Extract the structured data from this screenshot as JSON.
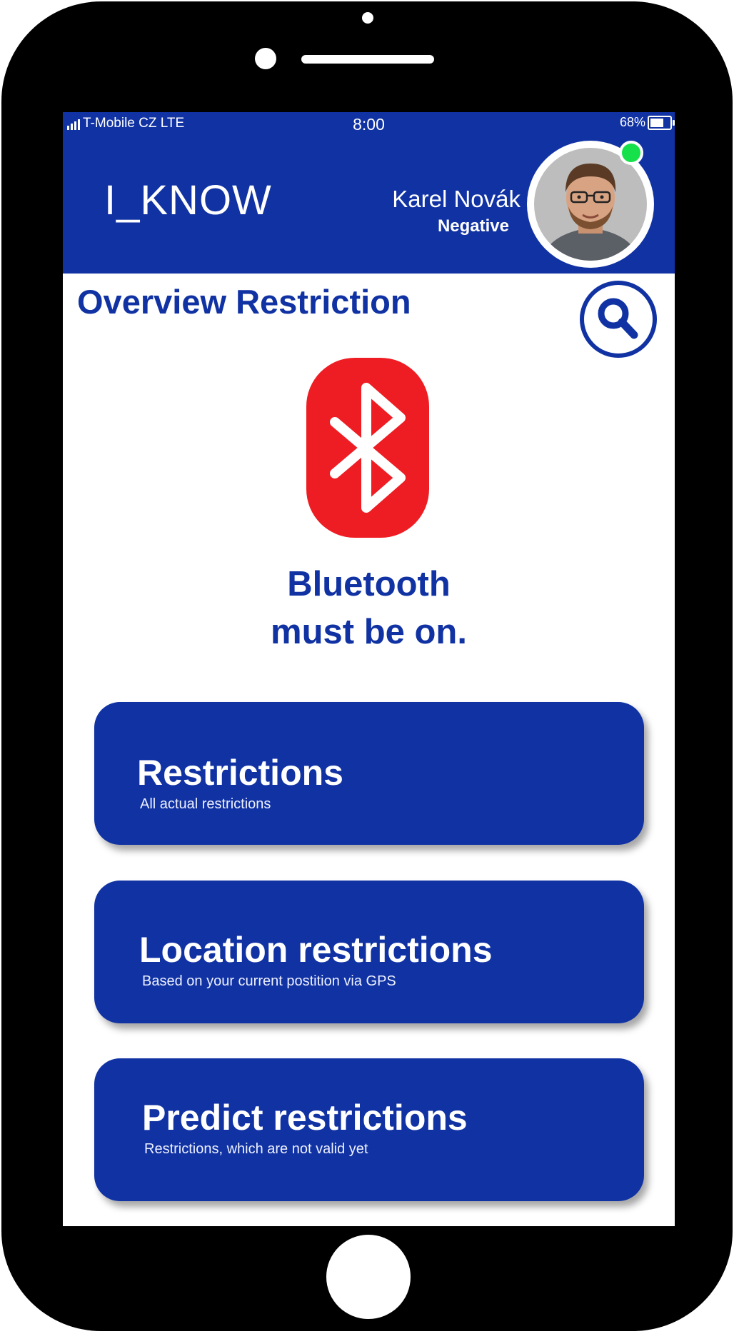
{
  "status_bar": {
    "carrier": "T-Mobile CZ LTE",
    "time": "8:00",
    "battery_percent": "68%",
    "battery_level": 0.68,
    "signal_icon": "signal-bars-icon",
    "battery_icon": "battery-icon"
  },
  "header": {
    "logo": "I_KNOW",
    "user_name": "Karel Novák",
    "user_status": "Negative",
    "online_indicator_color": "#16e04a"
  },
  "main": {
    "title": "Overview Restriction",
    "search_icon": "search-icon",
    "bluetooth_icon": "bluetooth-icon",
    "bluetooth_line1": "Bluetooth",
    "bluetooth_line2": "must be on."
  },
  "cards": [
    {
      "title": "Restrictions",
      "subtitle": "All actual restrictions"
    },
    {
      "title": "Location restrictions",
      "subtitle": "Based on your current postition via GPS"
    },
    {
      "title": "Predict restrictions",
      "subtitle": "Restrictions, which are not valid yet"
    }
  ],
  "colors": {
    "brand_blue": "#1032a3",
    "bluetooth_red": "#ee1d23",
    "online_green": "#16e04a",
    "device_frame": "#000000"
  }
}
